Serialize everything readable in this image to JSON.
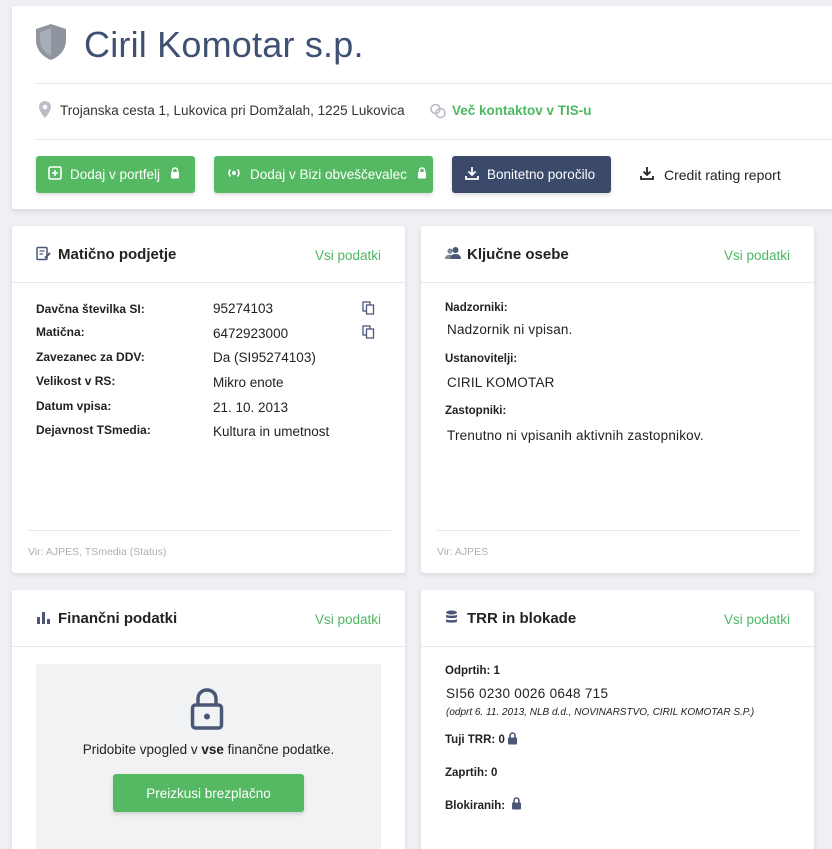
{
  "company": {
    "name": "Ciril Komotar s.p.",
    "address": "Trojanska cesta 1, Lukovica pri Domžalah, 1225 Lukovica",
    "contacts_link": "Več kontaktov v TIS-u"
  },
  "actions": {
    "add_portfolio": "Dodaj v portfelj",
    "add_bizi": "Dodaj v Bizi obveščevalec",
    "credit_report": "Bonitetno poročilo",
    "credit_rating_report": "Credit rating report"
  },
  "maticno": {
    "title": "Matično podjetje",
    "all_data": "Vsi podatki",
    "rows": [
      {
        "label": "Davčna številka SI:",
        "value": "95274103"
      },
      {
        "label": "Matična:",
        "value": "6472923000"
      },
      {
        "label": "Zavezanec za DDV:",
        "value": "Da (SI95274103)"
      },
      {
        "label": "Velikost v RS:",
        "value": "Mikro enote"
      },
      {
        "label": "Datum vpisa:",
        "value": "21. 10. 2013"
      },
      {
        "label": "Dejavnost TSmedia:",
        "value": "Kultura in umetnost"
      }
    ],
    "source": "Vir: AJPES, TSmedia (Status)"
  },
  "osebe": {
    "title": "Ključne osebe",
    "all_data": "Vsi podatki",
    "nadzorniki_label": "Nadzorniki:",
    "nadzorniki_value": "Nadzornik ni vpisan.",
    "ustanovitelji_label": "Ustanovitelji:",
    "ustanovitelji_value": "CIRIL KOMOTAR",
    "zastopniki_label": "Zastopniki:",
    "zastopniki_value": "Trenutno ni vpisanih aktivnih zastopnikov.",
    "source": "Vir: AJPES"
  },
  "financni": {
    "title": "Finančni podatki",
    "all_data": "Vsi podatki",
    "text_before": "Pridobite vpogled v ",
    "text_bold": "vse",
    "text_after": " finančne podatke.",
    "button": "Preizkusi brezplačno"
  },
  "trr": {
    "title": "TRR in blokade",
    "all_data": "Vsi podatki",
    "odprtih": "Odprtih: 1",
    "iban": "SI56 0230 0026 0648 715",
    "iban_note": "(odprt 6. 11. 2013, NLB d.d., NOVINARSTVO, CIRIL KOMOTAR S.P.)",
    "tuji": "Tuji TRR: 0",
    "zaprtih": "Zaprtih: 0",
    "blokiranih": "Blokiranih:"
  },
  "colors": {
    "green": "#54b962",
    "navy": "#3b4a6b",
    "title_blue": "#3f5173"
  }
}
